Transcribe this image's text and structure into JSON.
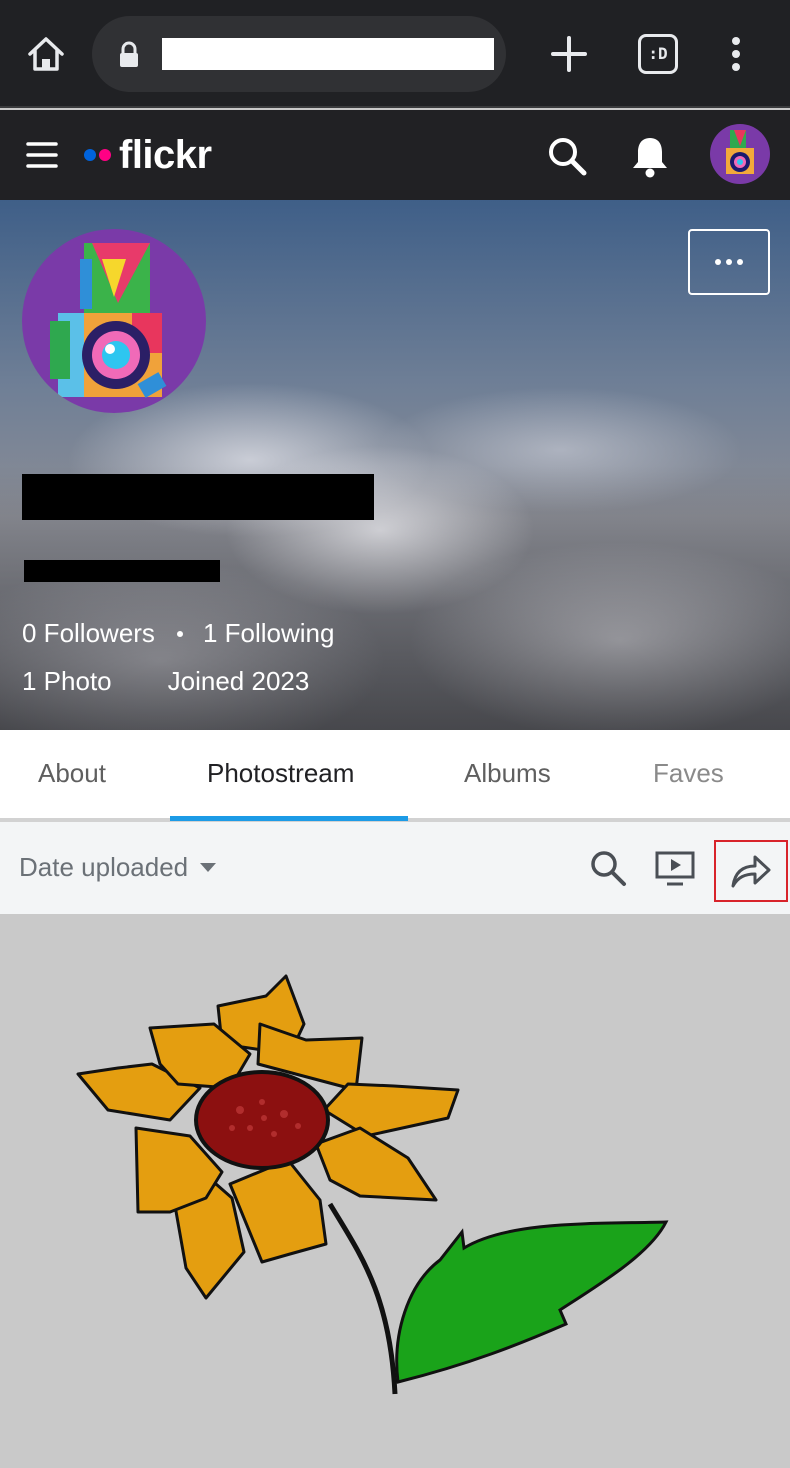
{
  "browser": {
    "home_icon": "home-icon",
    "lock_icon": "lock-icon",
    "tab_switcher_label": ":D",
    "new_tab_icon": "plus-icon",
    "menu_icon": "more-vertical-icon"
  },
  "header": {
    "logo_text": "flickr",
    "logo_colors": {
      "blue": "#0063dc",
      "pink": "#ff0084"
    },
    "icons": [
      "menu-icon",
      "search-icon",
      "bell-icon",
      "avatar"
    ]
  },
  "profile": {
    "stats": {
      "followers": "0 Followers",
      "following": "1 Following",
      "photos": "1 Photo",
      "joined": "Joined 2023"
    }
  },
  "tabs": [
    {
      "label": "About"
    },
    {
      "label": "Photostream",
      "active": true
    },
    {
      "label": "Albums"
    },
    {
      "label": "Faves"
    }
  ],
  "toolbar": {
    "sort_label": "Date uploaded",
    "accent": "#1c9be6",
    "highlight": "#d8232a"
  }
}
